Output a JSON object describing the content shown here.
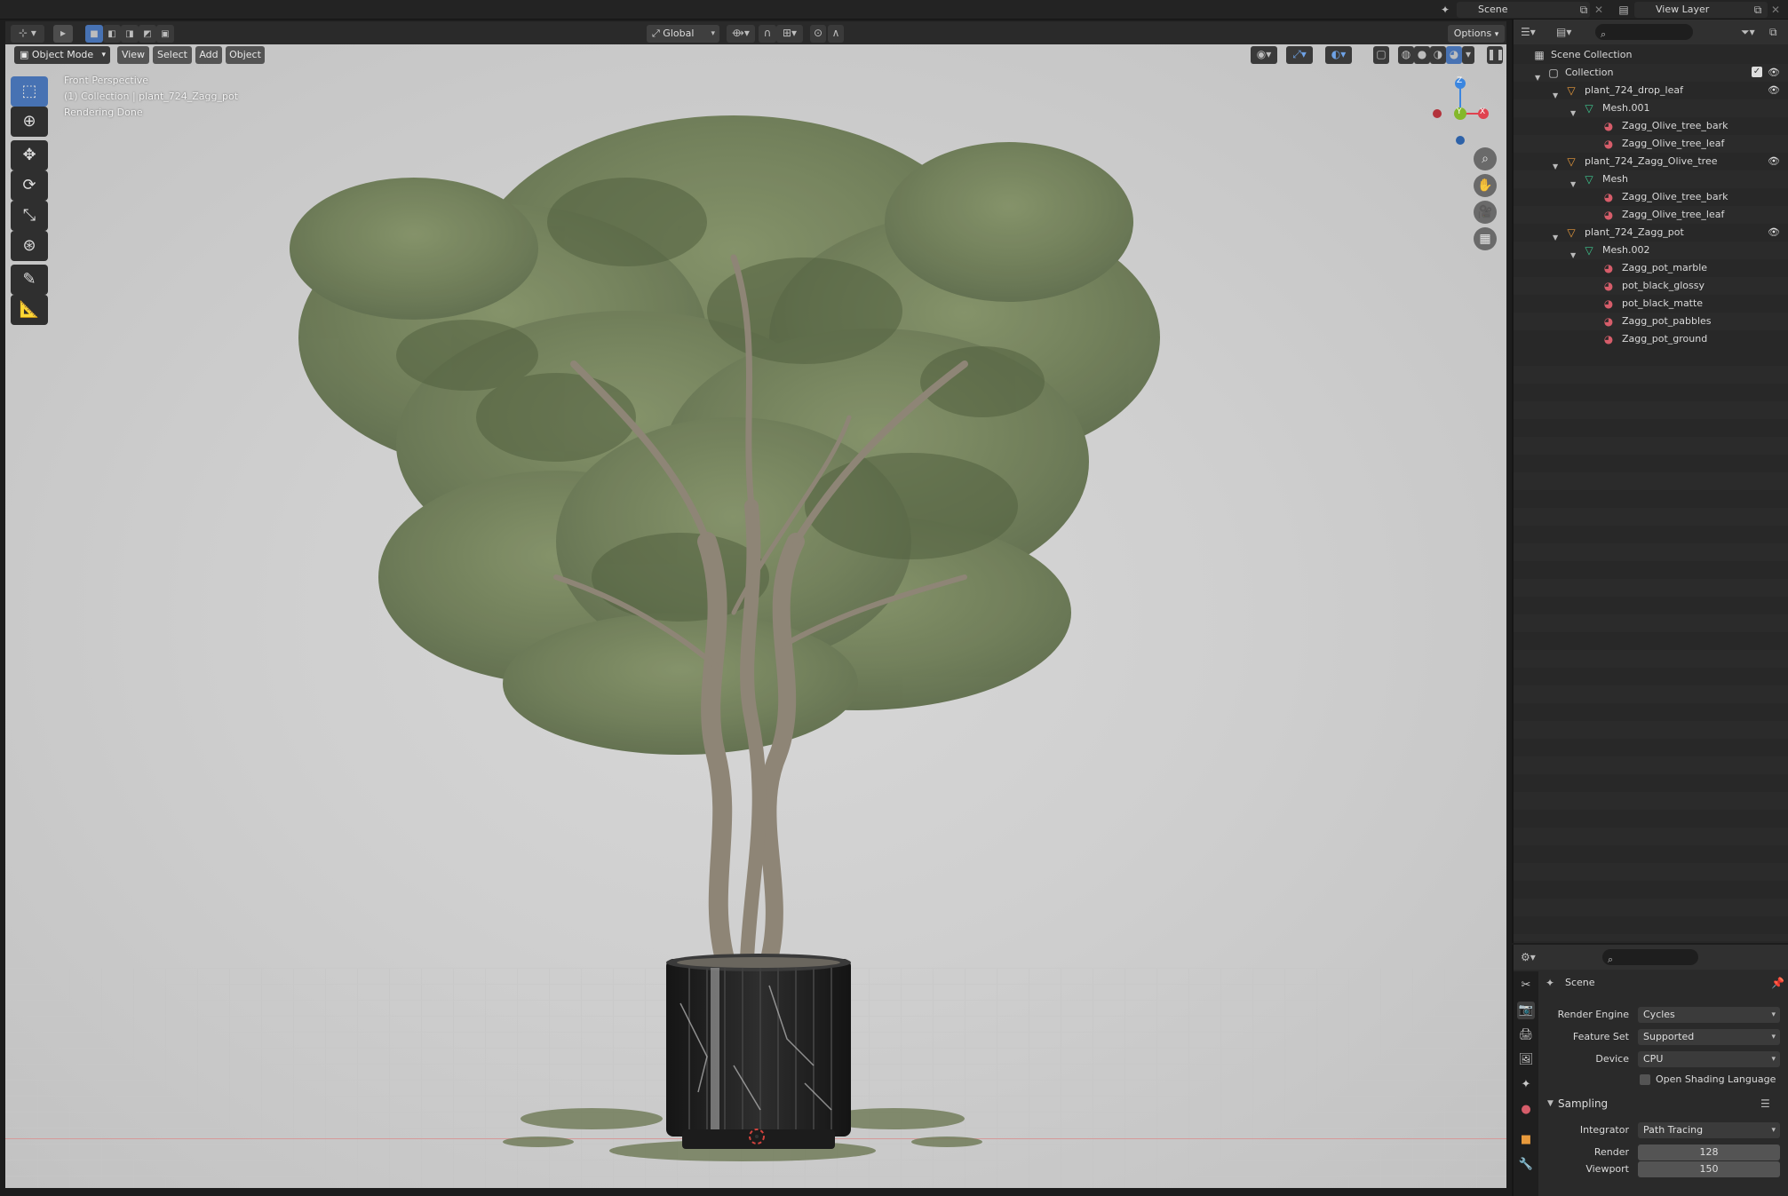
{
  "topbar": {
    "scene_label": "Scene",
    "view_layer_label": "View Layer"
  },
  "vp_toolbar": {
    "orientation": "Global",
    "options_label": "Options"
  },
  "vp_menus": {
    "mode": "Object Mode",
    "view": "View",
    "select": "Select",
    "add": "Add",
    "object": "Object"
  },
  "viewport_info": {
    "perspective": "Front Perspective",
    "collection_line": "(1) Collection | plant_724_Zagg_pot",
    "status": "Rendering Done"
  },
  "gizmo": {
    "z": "Z",
    "y": "Y",
    "x": "X"
  },
  "outliner": {
    "scene_collection": "Scene Collection",
    "rows": [
      {
        "label": "Collection",
        "kind": "collection"
      },
      {
        "label": "plant_724_drop_leaf",
        "kind": "object"
      },
      {
        "label": "Mesh.001",
        "kind": "mesh"
      },
      {
        "label": "Zagg_Olive_tree_bark",
        "kind": "material"
      },
      {
        "label": "Zagg_Olive_tree_leaf",
        "kind": "material"
      },
      {
        "label": "plant_724_Zagg_Olive_tree",
        "kind": "object"
      },
      {
        "label": "Mesh",
        "kind": "mesh"
      },
      {
        "label": "Zagg_Olive_tree_bark",
        "kind": "material"
      },
      {
        "label": "Zagg_Olive_tree_leaf",
        "kind": "material"
      },
      {
        "label": "plant_724_Zagg_pot",
        "kind": "object"
      },
      {
        "label": "Mesh.002",
        "kind": "mesh"
      },
      {
        "label": "Zagg_pot_marble",
        "kind": "material"
      },
      {
        "label": "pot_black_glossy",
        "kind": "material"
      },
      {
        "label": "pot_black_matte",
        "kind": "material"
      },
      {
        "label": "Zagg_pot_pabbles",
        "kind": "material"
      },
      {
        "label": "Zagg_pot_ground",
        "kind": "material"
      }
    ]
  },
  "properties": {
    "context": "Scene",
    "render_engine_label": "Render Engine",
    "render_engine_value": "Cycles",
    "feature_set_label": "Feature Set",
    "feature_set_value": "Supported",
    "device_label": "Device",
    "device_value": "CPU",
    "osl_label": "Open Shading Language",
    "sampling_label": "Sampling",
    "integrator_label": "Integrator",
    "integrator_value": "Path Tracing",
    "render_label": "Render",
    "render_value": "128",
    "viewport_label": "Viewport",
    "viewport_value": "150"
  },
  "colors": {
    "accent": "#4772b3",
    "x_axis": "#e0424f",
    "y_axis": "#84b82b",
    "z_axis": "#3b86e0",
    "object_icon": "#e89a3c",
    "mesh_icon": "#3ec78f",
    "material_icon": "#d65d6a"
  }
}
